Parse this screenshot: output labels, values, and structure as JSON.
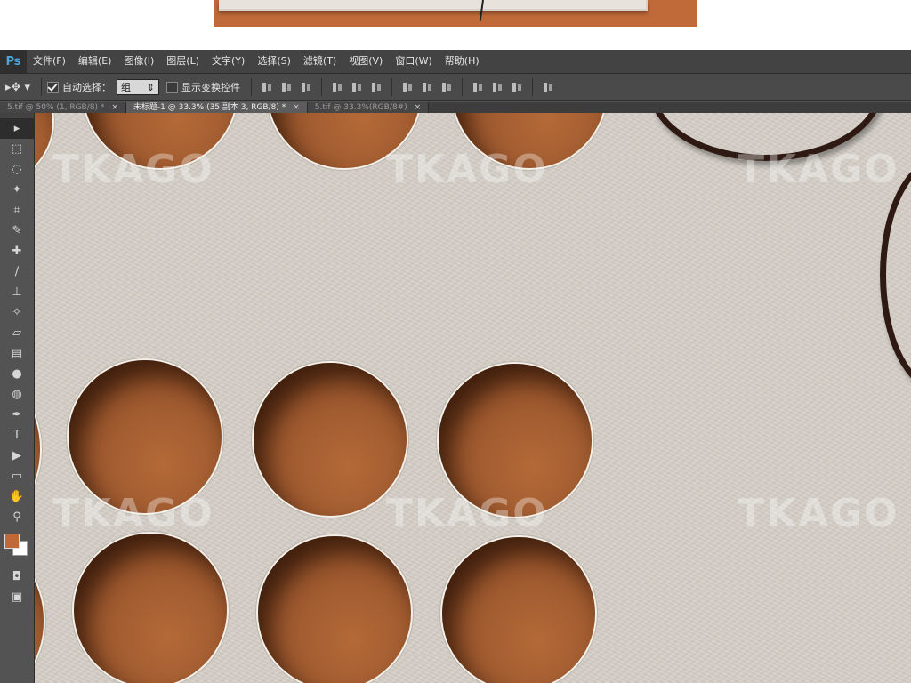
{
  "app": {
    "logo": "Ps"
  },
  "menu": [
    "文件(F)",
    "编辑(E)",
    "图像(I)",
    "图层(L)",
    "文字(Y)",
    "选择(S)",
    "滤镜(T)",
    "视图(V)",
    "窗口(W)",
    "帮助(H)"
  ],
  "options": {
    "auto_select_label": "自动选择：",
    "auto_select_value": "组",
    "show_transform_label": "显示变换控件"
  },
  "tabs": [
    {
      "label": "5.tif @ 50% (1, RGB/8) *"
    },
    {
      "label": "未标题-1 @ 33.3% (35 副本 3, RGB/8) *"
    },
    {
      "label": "5.tif @ 33.3%(RGB/8#)"
    }
  ],
  "tools": [
    "move-icon",
    "marquee-icon",
    "lasso-icon",
    "magic-wand-icon",
    "crop-icon",
    "eyedropper-icon",
    "healing-brush-icon",
    "brush-icon",
    "clone-stamp-icon",
    "history-brush-icon",
    "eraser-icon",
    "gradient-icon",
    "blur-icon",
    "dodge-icon",
    "pen-icon",
    "type-icon",
    "path-selection-icon",
    "rectangle-icon",
    "hand-icon",
    "zoom-icon"
  ],
  "tool_glyphs": [
    "▸",
    "⬚",
    "◌",
    "✦",
    "⌗",
    "✎",
    "✚",
    "∕",
    "⊥",
    "✧",
    "▱",
    "▤",
    "●",
    "◍",
    "✒",
    "T",
    "▶",
    "▭",
    "✋",
    "⚲"
  ],
  "colors": {
    "foreground": "#c0683a",
    "background": "#ffffff",
    "canvas": "#d5cfc7",
    "hole": "#9f5a2f"
  },
  "watermark": "TKAGO"
}
